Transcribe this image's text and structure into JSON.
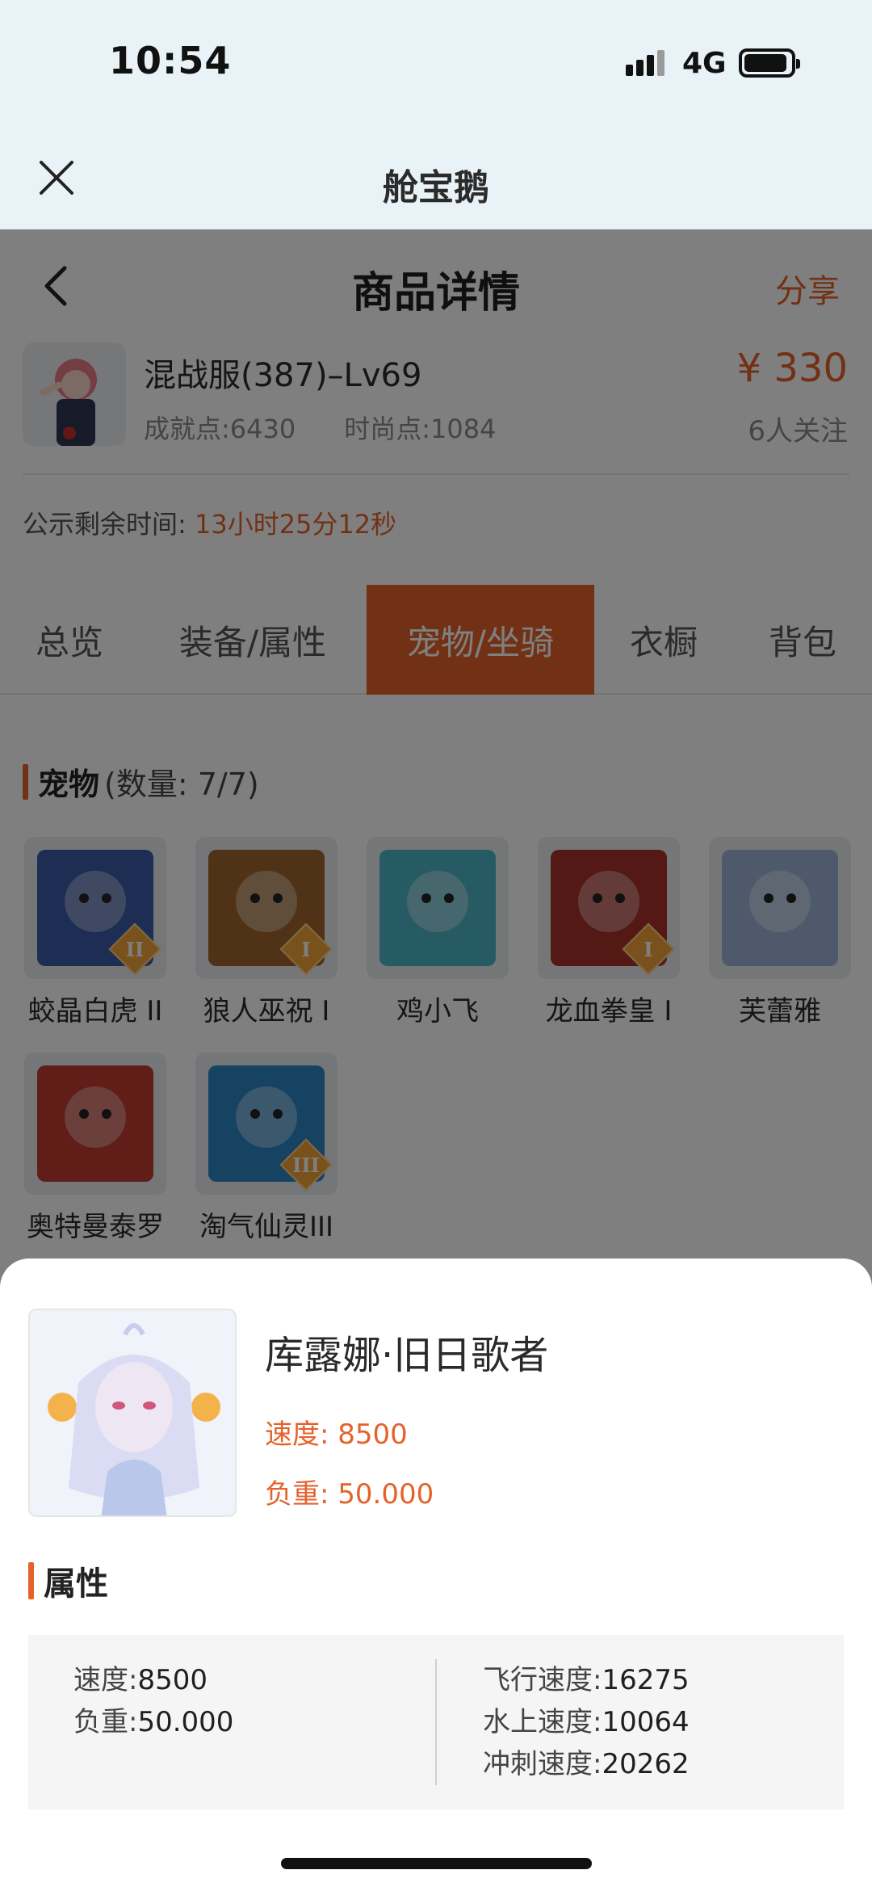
{
  "status_bar": {
    "time": "10:54",
    "network": "4G"
  },
  "webview": {
    "title": "舱宝鹅"
  },
  "nav": {
    "title": "商品详情",
    "share": "分享"
  },
  "product": {
    "name": "混战服(387)–Lv69",
    "achievement": "成就点:6430",
    "fashion": "时尚点:1084",
    "price": "¥ 330",
    "followers": "6人关注"
  },
  "countdown": {
    "label": "公示剩余时间:",
    "value": "13小时25分12秒"
  },
  "tabs": [
    {
      "label": "总览"
    },
    {
      "label": "装备/属性"
    },
    {
      "label": "宠物/坐骑",
      "active": true
    },
    {
      "label": "衣橱"
    },
    {
      "label": "背包"
    }
  ],
  "pets_section": {
    "title": "宠物",
    "count": "(数量: 7/7)"
  },
  "pets": [
    {
      "name": "蛟晶白虎 II",
      "badge": "II",
      "color": "#3b5ba6"
    },
    {
      "name": "狼人巫祝 I",
      "badge": "I",
      "color": "#a0672e"
    },
    {
      "name": "鸡小飞",
      "badge": "",
      "color": "#4fb6c7"
    },
    {
      "name": "龙血拳皇 I",
      "badge": "I",
      "color": "#a8322a"
    },
    {
      "name": "芙蕾雅",
      "badge": "",
      "color": "#9db4d9"
    },
    {
      "name": "奥特曼泰罗",
      "badge": "",
      "color": "#c23a30"
    },
    {
      "name": "淘气仙灵III",
      "badge": "III",
      "color": "#2e86c6"
    }
  ],
  "sheet": {
    "name": "库露娜·旧日歌者",
    "speed": "速度: 8500",
    "load": "负重: 50.000",
    "attr_title": "属性",
    "attrs_left": [
      {
        "label": "速度:",
        "value": "8500"
      },
      {
        "label": "负重:",
        "value": "50.000"
      }
    ],
    "attrs_right": [
      {
        "label": "飞行速度:",
        "value": "16275"
      },
      {
        "label": "水上速度:",
        "value": "10064"
      },
      {
        "label": "冲刺速度:",
        "value": "20262"
      }
    ]
  }
}
